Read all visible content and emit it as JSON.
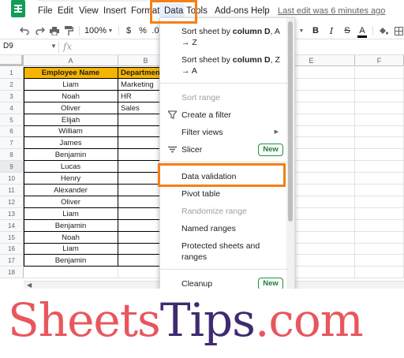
{
  "app": {
    "menu": [
      "File",
      "Edit",
      "View",
      "Insert",
      "Format",
      "Data",
      "Tools",
      "Add-ons",
      "Help"
    ],
    "last_edit": "Last edit was 6 minutes ago"
  },
  "toolbar": {
    "zoom": "100%",
    "currency": "$",
    "percent": "%",
    "decimal": ".0",
    "bold": "B",
    "italic": "I",
    "strike": "S",
    "text_color": "A"
  },
  "formula_bar": {
    "name_box": "D9",
    "fx": "fx"
  },
  "columns": [
    "A",
    "B",
    "E",
    "F"
  ],
  "rows": [
    "1",
    "2",
    "3",
    "4",
    "5",
    "6",
    "7",
    "8",
    "9",
    "10",
    "11",
    "12",
    "13",
    "14",
    "15",
    "16",
    "17",
    "18"
  ],
  "table": {
    "headers": [
      "Employee Name",
      "Departmen"
    ],
    "names": [
      "Liam",
      "Noah",
      "Oliver",
      "Elijah",
      "William",
      "James",
      "Benjamin",
      "Lucas",
      "Henry",
      "Alexander",
      "Oliver",
      "Liam",
      "Benjamin",
      "Noah",
      "Liam",
      "Benjamin"
    ],
    "departments": [
      "Marketing",
      "HR",
      "Sales"
    ]
  },
  "data_menu": {
    "items": [
      {
        "label1": "Sort sheet by ",
        "bold": "column D",
        "label2": ", A",
        "line2": "→ Z"
      },
      {
        "label1": "Sort sheet by ",
        "bold": "column D",
        "label2": ", Z",
        "line2": "→ A"
      },
      {
        "label": "Sort range"
      },
      {
        "label": "Create a filter"
      },
      {
        "label": "Filter views"
      },
      {
        "label": "Slicer",
        "badge": "New"
      },
      {
        "label": "Data validation"
      },
      {
        "label": "Pivot table"
      },
      {
        "label": "Randomize range"
      },
      {
        "label": "Named ranges"
      },
      {
        "label": "Protected sheets and",
        "line2": "ranges"
      },
      {
        "label": "Cleanup",
        "badge": "New"
      }
    ]
  },
  "colors": {
    "header_fill": "#f4b400",
    "highlight": "#f57f17",
    "badge": "#188038"
  },
  "watermark": {
    "part1": "Sheets",
    "part2": "Tips",
    "part3": ".com"
  }
}
